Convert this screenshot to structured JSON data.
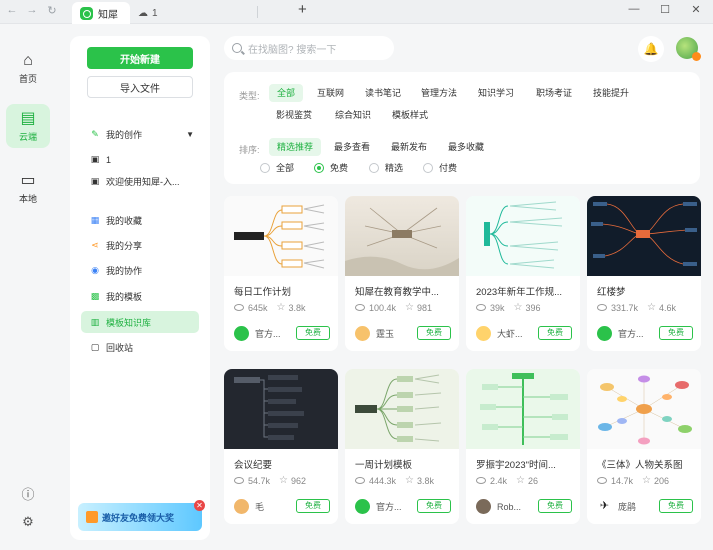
{
  "titlebar": {
    "active_tab_label": "知犀",
    "second_tab_label": "1",
    "back_icon": "arrow-left-icon",
    "forward_icon": "arrow-right-icon",
    "refresh_icon": "refresh-icon"
  },
  "rail": {
    "home_label": "首页",
    "cloud_label": "云端",
    "local_label": "本地"
  },
  "sidebar": {
    "new_button": "开始新建",
    "import_button": "导入文件",
    "my_creations": "我的创作",
    "items_files": [
      "1",
      "欢迎使用知犀-入..."
    ],
    "items": [
      "我的收藏",
      "我的分享",
      "我的协作",
      "我的模板",
      "模板知识库",
      "回收站"
    ],
    "active_item": "模板知识库",
    "promo": "邀好友免费领大奖"
  },
  "search": {
    "placeholder": "在找脑图? 搜索一下"
  },
  "filter": {
    "type_label": "类型:",
    "types_row1": [
      "全部",
      "互联网",
      "读书笔记",
      "管理方法",
      "知识学习",
      "职场考证",
      "技能提升"
    ],
    "types_row2": [
      "影视鉴赏",
      "综合知识",
      "模板样式"
    ],
    "sort_label": "排序:",
    "sorts": [
      "精选推荐",
      "最多查看",
      "最新发布",
      "最多收藏"
    ],
    "price": [
      "全部",
      "免费",
      "精选",
      "付费"
    ],
    "selected_type": "全部",
    "selected_sort": "精选推荐",
    "selected_price": "免费"
  },
  "cards": [
    {
      "title": "每日工作计划",
      "views": "645k",
      "stars": "3.8k",
      "author": "官方...",
      "badge": "免费"
    },
    {
      "title": "知犀在教育教学中...",
      "views": "100.4k",
      "stars": "981",
      "author": "霆玉",
      "badge": "免费"
    },
    {
      "title": "2023年新年工作规...",
      "views": "39k",
      "stars": "396",
      "author": "大虾...",
      "badge": "免费"
    },
    {
      "title": "红楼梦",
      "views": "331.7k",
      "stars": "4.6k",
      "author": "官方...",
      "badge": "免费"
    },
    {
      "title": "会议纪要",
      "views": "54.7k",
      "stars": "962",
      "author": "毛",
      "badge": "免费"
    },
    {
      "title": "一周计划模板",
      "views": "444.3k",
      "stars": "3.8k",
      "author": "官方...",
      "badge": "免费"
    },
    {
      "title": "罗振宇2023\"时间...",
      "views": "2.4k",
      "stars": "26",
      "author": "Rob...",
      "badge": "免费"
    },
    {
      "title": "《三体》人物关系图",
      "views": "14.7k",
      "stars": "206",
      "author": "庞鹃",
      "badge": "免费"
    }
  ],
  "colors": {
    "accent": "#2bc24a",
    "accent_light": "#d8f4de"
  }
}
